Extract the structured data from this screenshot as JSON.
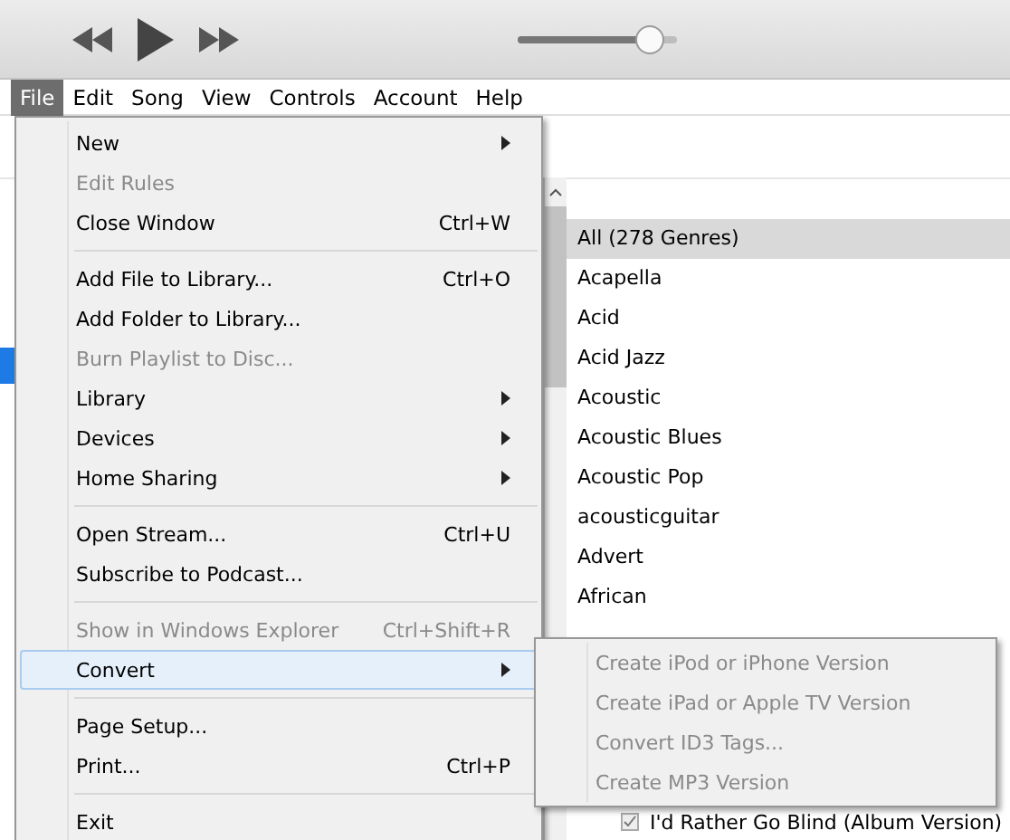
{
  "player": {
    "volume": {
      "level": 0.83
    }
  },
  "menubar": [
    {
      "label": "File",
      "selected": true
    },
    {
      "label": "Edit",
      "selected": false
    },
    {
      "label": "Song",
      "selected": false
    },
    {
      "label": "View",
      "selected": false
    },
    {
      "label": "Controls",
      "selected": false
    },
    {
      "label": "Account",
      "selected": false
    },
    {
      "label": "Help",
      "selected": false
    }
  ],
  "genres": [
    {
      "label": "All (278 Genres)",
      "selected": true
    },
    {
      "label": "Acapella",
      "selected": false
    },
    {
      "label": "Acid",
      "selected": false
    },
    {
      "label": "Acid Jazz",
      "selected": false
    },
    {
      "label": "Acoustic",
      "selected": false
    },
    {
      "label": "Acoustic Blues",
      "selected": false
    },
    {
      "label": "Acoustic Pop",
      "selected": false
    },
    {
      "label": "acousticguitar",
      "selected": false
    },
    {
      "label": "Advert",
      "selected": false
    },
    {
      "label": "African",
      "selected": false
    }
  ],
  "song": {
    "title": "I'd Rather Go Blind (Album Version)",
    "checked": true
  },
  "file_menu": [
    {
      "kind": "item",
      "label": "New",
      "disabled": false,
      "selected": false,
      "submenu": true
    },
    {
      "kind": "item",
      "label": "Edit Rules",
      "disabled": true,
      "selected": false,
      "submenu": false
    },
    {
      "kind": "item",
      "label": "Close Window",
      "shortcut": "Ctrl+W",
      "disabled": false,
      "selected": false,
      "submenu": false
    },
    {
      "kind": "separator"
    },
    {
      "kind": "item",
      "label": "Add File to Library...",
      "shortcut": "Ctrl+O",
      "disabled": false,
      "selected": false,
      "submenu": false
    },
    {
      "kind": "item",
      "label": "Add Folder to Library...",
      "disabled": false,
      "selected": false,
      "submenu": false
    },
    {
      "kind": "item",
      "label": "Burn Playlist to Disc...",
      "disabled": true,
      "selected": false,
      "submenu": false
    },
    {
      "kind": "item",
      "label": "Library",
      "disabled": false,
      "selected": false,
      "submenu": true
    },
    {
      "kind": "item",
      "label": "Devices",
      "disabled": false,
      "selected": false,
      "submenu": true
    },
    {
      "kind": "item",
      "label": "Home Sharing",
      "disabled": false,
      "selected": false,
      "submenu": true
    },
    {
      "kind": "separator"
    },
    {
      "kind": "item",
      "label": "Open Stream...",
      "shortcut": "Ctrl+U",
      "disabled": false,
      "selected": false,
      "submenu": false
    },
    {
      "kind": "item",
      "label": "Subscribe to Podcast...",
      "disabled": false,
      "selected": false,
      "submenu": false
    },
    {
      "kind": "separator"
    },
    {
      "kind": "item",
      "label": "Show in Windows Explorer",
      "shortcut": "Ctrl+Shift+R",
      "disabled": true,
      "selected": false,
      "submenu": false
    },
    {
      "kind": "item",
      "label": "Convert",
      "disabled": false,
      "selected": true,
      "submenu": true
    },
    {
      "kind": "separator"
    },
    {
      "kind": "item",
      "label": "Page Setup...",
      "disabled": false,
      "selected": false,
      "submenu": false
    },
    {
      "kind": "item",
      "label": "Print...",
      "shortcut": "Ctrl+P",
      "disabled": false,
      "selected": false,
      "submenu": false
    },
    {
      "kind": "separator"
    },
    {
      "kind": "item",
      "label": "Exit",
      "disabled": false,
      "selected": false,
      "submenu": false
    }
  ],
  "convert_menu": [
    {
      "label": "Create iPod or iPhone Version",
      "disabled": true
    },
    {
      "label": "Create iPad or Apple TV Version",
      "disabled": true
    },
    {
      "label": "Convert ID3 Tags...",
      "disabled": true
    },
    {
      "label": "Create MP3 Version",
      "disabled": true
    }
  ]
}
